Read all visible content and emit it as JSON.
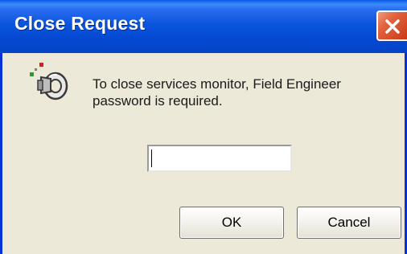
{
  "window": {
    "title": "Close Request"
  },
  "dialog": {
    "message_line1": "To close services monitor, Field Engineer",
    "message_line2": "password is required.",
    "password_value": "",
    "ok_label": "OK",
    "cancel_label": "Cancel"
  },
  "icons": {
    "title_close": "close-icon",
    "dialog": "key-icon"
  },
  "colors": {
    "titlebar": "#0a55dd",
    "close_button": "#e2623f",
    "dialog_background": "#ece9d8"
  }
}
